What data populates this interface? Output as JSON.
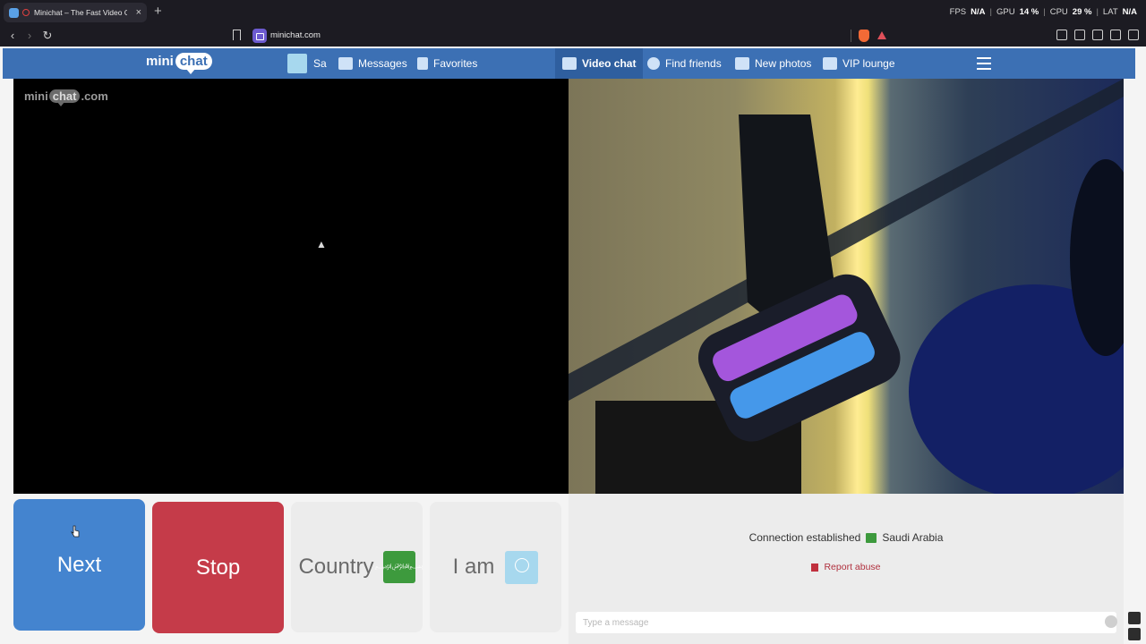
{
  "browser": {
    "tab_title": "Minichat – The Fast Video Ch",
    "url": "minichat.com",
    "sysinfo": {
      "fps_label": "FPS",
      "fps_value": "N/A",
      "gpu_label": "GPU",
      "gpu_value": "14 %",
      "cpu_label": "CPU",
      "cpu_value": "29 %",
      "lat_label": "LAT",
      "lat_value": "N/A"
    }
  },
  "site": {
    "logo_left": "mini",
    "logo_right": "chat",
    "nav": {
      "profile_name": "Sa",
      "messages": "Messages",
      "favorites": "Favorites",
      "video_chat": "Video chat",
      "find_friends": "Find friends",
      "new_photos": "New photos",
      "vip_lounge": "VIP lounge"
    },
    "watermark": {
      "a": "mini",
      "b": "chat",
      "c": ".com"
    },
    "controls": {
      "next": "Next",
      "stop": "Stop",
      "country": "Country",
      "i_am": "I am"
    },
    "status": {
      "connection": "Connection established",
      "country": "Saudi Arabia",
      "report": "Report abuse"
    },
    "message_placeholder": "Type a message"
  },
  "colors": {
    "nav_blue": "#3c70b4",
    "next_blue": "#4484cf",
    "stop_red": "#c53b49",
    "flag_green": "#3d9a3d"
  }
}
